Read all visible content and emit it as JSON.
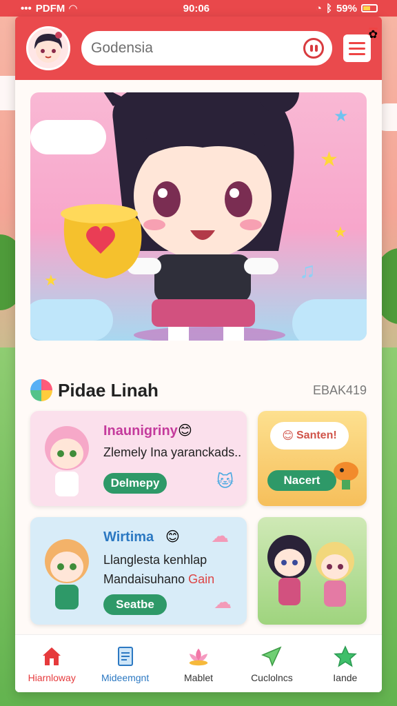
{
  "status_bar": {
    "carrier": "PDFM",
    "time": "90:06",
    "battery": "59%"
  },
  "header": {
    "search_value": "Godensia"
  },
  "section": {
    "title": "Pidae Linah",
    "code": "EBAK419"
  },
  "cards": [
    {
      "title": "Inaunigriny",
      "line1": "Zlemely Ina yaranckads..",
      "button": "Delmepy"
    },
    {
      "bubble": "Santen!",
      "button": "Nacert"
    },
    {
      "title": "Wirtima",
      "line1": "Llanglesta kenhlap",
      "line2_prefix": "Mandaisuhano ",
      "line2_highlight": "Gain",
      "button": "Seatbe"
    },
    {
      "caption": ""
    }
  ],
  "tabs": [
    {
      "label": "Hiarnloway",
      "icon": "home-icon",
      "color": "#e63a3c"
    },
    {
      "label": "Mideemgnt",
      "icon": "document-icon",
      "color": "#2b78c2"
    },
    {
      "label": "Mablet",
      "icon": "lotus-icon",
      "color": "#333"
    },
    {
      "label": "Cuclolncs",
      "icon": "send-icon",
      "color": "#333"
    },
    {
      "label": "Iande",
      "icon": "star-icon",
      "color": "#333"
    }
  ],
  "colors": {
    "header_red": "#ea4a4d",
    "pill_green": "#2e9968",
    "card_pink": "#fbe0ec",
    "card_yellow": "#fcd37a",
    "card_blue": "#d8ecf8",
    "card_green": "#bfe3a6"
  }
}
